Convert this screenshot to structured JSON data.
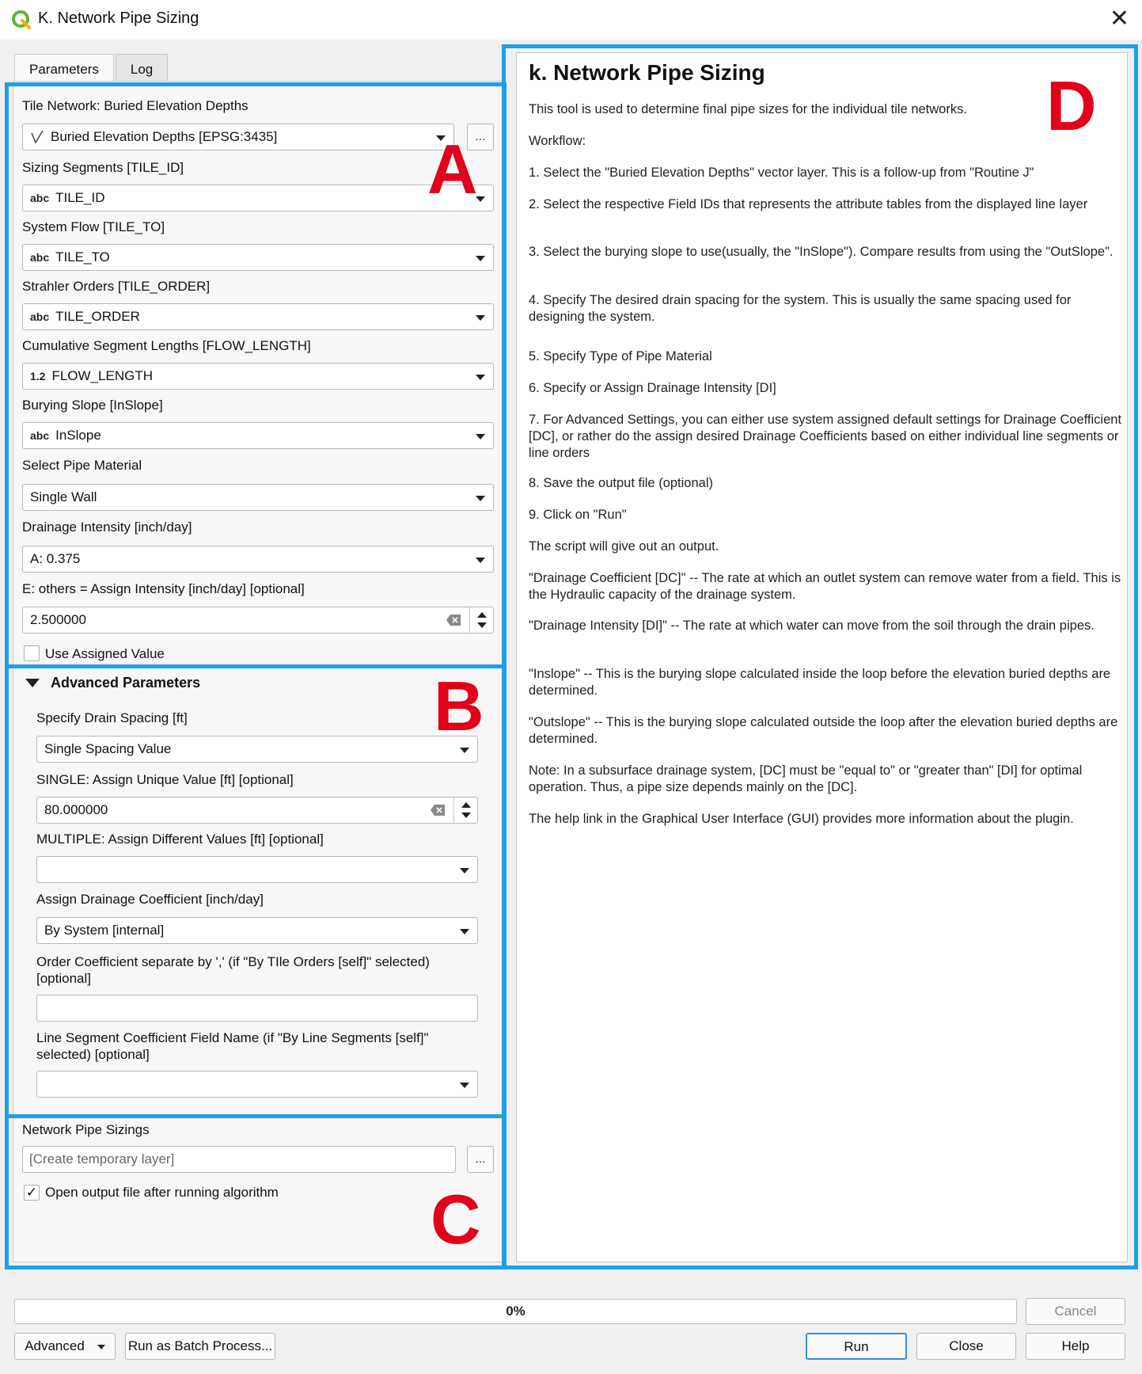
{
  "window": {
    "title": "K. Network Pipe Sizing",
    "app_icon": "qgis-icon",
    "close_glyph": "✕"
  },
  "tabs": [
    "Parameters",
    "Log"
  ],
  "annotations": {
    "a": "A",
    "b": "B",
    "c": "C",
    "d": "D"
  },
  "section_a": {
    "tile_network_label": "Tile Network: Buried Elevation Depths",
    "tile_network_value": "Buried Elevation Depths [EPSG:3435]",
    "browse_glyph": "…",
    "sizing_segments_label": "Sizing Segments [TILE_ID]",
    "sizing_segments_type": "abc",
    "sizing_segments_value": "TILE_ID",
    "system_flow_label": "System Flow [TILE_TO]",
    "system_flow_type": "abc",
    "system_flow_value": "TILE_TO",
    "strahler_label": "Strahler Orders [TILE_ORDER]",
    "strahler_type": "abc",
    "strahler_value": "TILE_ORDER",
    "cumulative_label": "Cumulative Segment Lengths [FLOW_LENGTH]",
    "cumulative_type": "1.2",
    "cumulative_value": "FLOW_LENGTH",
    "burying_slope_label": "Burying Slope [InSlope]",
    "burying_slope_type": "abc",
    "burying_slope_value": "InSlope",
    "pipe_material_label": "Select Pipe Material",
    "pipe_material_value": "Single Wall",
    "drainage_intensity_label": "Drainage Intensity [inch/day]",
    "drainage_intensity_value": "A: 0.375",
    "assign_intensity_label": "E: others = Assign Intensity [inch/day] [optional]",
    "assign_intensity_value": "2.500000",
    "use_assigned_label": "Use Assigned Value",
    "use_assigned_checked": false
  },
  "section_b": {
    "header": "Advanced Parameters",
    "drain_spacing_label": "Specify Drain Spacing [ft]",
    "drain_spacing_value": "Single Spacing Value",
    "single_value_label": "SINGLE: Assign Unique Value [ft] [optional]",
    "single_value_value": "80.000000",
    "multiple_label": "MULTIPLE: Assign Different Values [ft] [optional]",
    "multiple_value": "",
    "coefficient_label": "Assign Drainage Coefficient [inch/day]",
    "coefficient_value": "By System [internal]",
    "order_coeff_label_1": "Order Coefficient separate by ',' (if \"By TIle Orders [self]\" selected)",
    "order_coeff_label_2": "[optional]",
    "order_coeff_value": "",
    "line_seg_label_1": "Line Segment Coefficient Field Name (if \"By Line Segments [self]\"",
    "line_seg_label_2": "selected) [optional]",
    "line_seg_value": ""
  },
  "section_c": {
    "output_label": "Network Pipe Sizings",
    "output_placeholder": "[Create temporary layer]",
    "open_output_label": "Open output file after running algorithm",
    "open_output_checked": true,
    "check_glyph": "✓"
  },
  "help": {
    "title": "k. Network Pipe Sizing",
    "paragraphs": [
      "This tool is used to determine final pipe sizes for the individual tile networks.",
      "Workflow:",
      "1. Select the \"Buried Elevation Depths\" vector layer. This is a follow-up from \"Routine J\"",
      "2. Select the respective Field IDs that represents the attribute tables from the displayed line layer",
      "3. Select the burying slope to use(usually, the \"InSlope\"). Compare results from using the \"OutSlope\".",
      "4. Specify The desired drain spacing for the system. This is usually the same spacing used for designing the system.",
      "5. Specify Type of Pipe Material",
      "6. Specify or Assign Drainage Intensity [DI]",
      "7. For Advanced Settings, you can either use system assigned default settings for Drainage Coefficient [DC], or rather do the assign desired Drainage Coefficients based on either individual line segments or line orders",
      "8. Save the output file (optional)",
      "9. Click on \"Run\"",
      "The script will give out an output.",
      "\"Drainage Coefficient [DC]\" -- The rate at which an outlet system can remove water from a field. This is the Hydraulic capacity of the drainage system.",
      "\"Drainage Intensity [DI]\" -- The rate at which water can move from the soil through the drain pipes.",
      "\"Inslope\" -- This is the burying slope calculated inside the loop before the elevation buried depths are determined.",
      "\"Outslope\" -- This is the burying slope calculated outside the loop after the elevation buried depths are determined.",
      "Note: In a subsurface drainage system, [DC] must be \"equal to\" or \"greater than\" [DI] for optimal operation. Thus, a pipe size depends mainly on the [DC].",
      "The help link in the Graphical User Interface (GUI) provides more information about the plugin."
    ]
  },
  "footer": {
    "progress": 0,
    "progress_text": "0%",
    "cancel": "Cancel",
    "advanced": "Advanced",
    "batch": "Run as Batch Process...",
    "run": "Run",
    "close": "Close",
    "help": "Help"
  },
  "colors": {
    "annotation_box": "#1ea0e6",
    "annotation_letter": "#e2001a",
    "qgis_green": "#5cb531"
  }
}
